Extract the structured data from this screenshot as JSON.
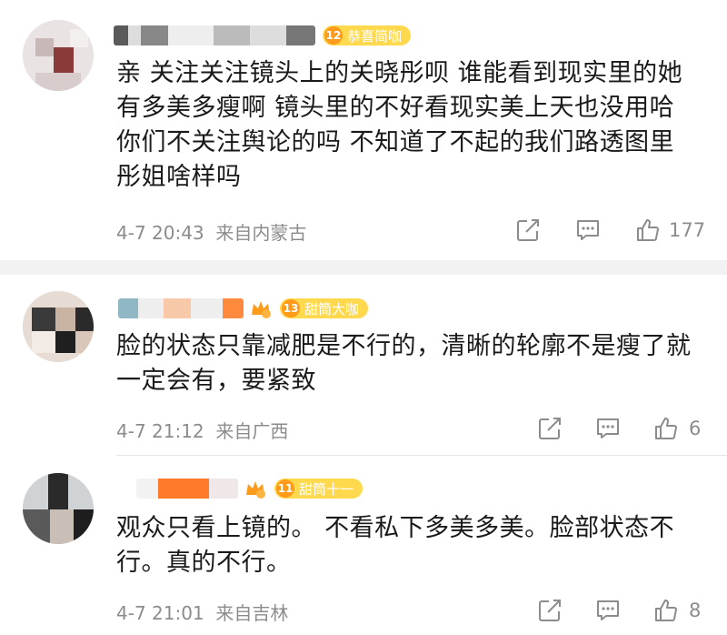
{
  "comments": [
    {
      "badge_level": "12",
      "badge_text": "恭喜简咖",
      "text": "亲 关注关注镜头上的关晓彤呗 谁能看到现实里的她有多美多瘦啊 镜头里的不好看现实美上天也没用哈 你们不关注舆论的吗 不知道了不起的我们路透图里彤姐啥样吗",
      "time": "4-7 20:43",
      "location": "来自内蒙古",
      "likes": "177"
    },
    {
      "badge_level": "13",
      "badge_text": "甜筒大咖",
      "text": "脸的状态只靠减肥是不行的，清晰的轮廓不是瘦了就一定会有，要紧致",
      "time": "4-7 21:12",
      "location": "来自广西",
      "likes": "6"
    },
    {
      "badge_level": "11",
      "badge_text": "甜筒十一",
      "text": "观众只看上镜的。 不看私下多美多美。脸部状态不行。真的不行。",
      "time": "4-7 21:01",
      "location": "来自吉林",
      "likes": "8"
    }
  ],
  "colors": {
    "badge_bg": "#ffd94d",
    "badge_level": "#ff9b1a",
    "meta_text": "#8c8c8c",
    "body_text": "#1a1a1a"
  },
  "icons": [
    "share-icon",
    "comment-icon",
    "like-icon"
  ]
}
